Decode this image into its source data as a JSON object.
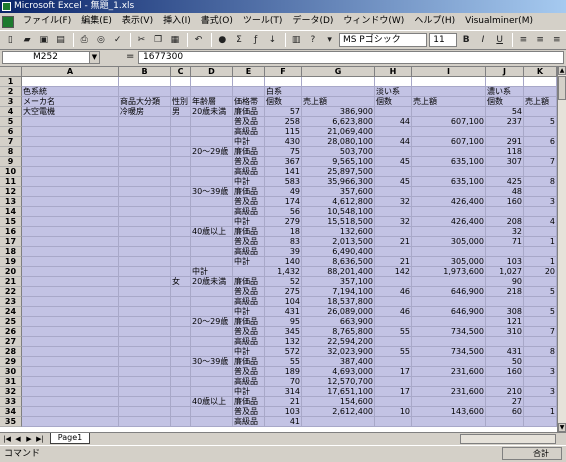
{
  "window": {
    "title": "Microsoft Excel - 無題_1.xls"
  },
  "menu": [
    "ファイル(F)",
    "編集(E)",
    "表示(V)",
    "挿入(I)",
    "書式(O)",
    "ツール(T)",
    "データ(D)",
    "ウィンドウ(W)",
    "ヘルプ(H)",
    "Visualminer(M)"
  ],
  "toolbar": {
    "font_name": "MS Pゴシック",
    "font_size": "11",
    "zoom": "Σ",
    "bold_label": "B",
    "italic_label": "I",
    "underline_label": "U"
  },
  "formula_bar": {
    "name_box": "M252",
    "eq": "=",
    "value": "1677300"
  },
  "columns": [
    "A",
    "B",
    "C",
    "D",
    "E",
    "F",
    "G",
    "H",
    "I",
    "J",
    "K"
  ],
  "rows": [
    [
      "",
      "",
      "",
      "",
      "",
      "",
      "",
      "",
      "",
      "",
      ""
    ],
    [
      "色系統",
      "",
      "",
      "",
      "",
      "白系",
      "",
      "淡い系",
      "",
      "濃い系",
      ""
    ],
    [
      "メーカ名",
      "商品大分類",
      "性別",
      "年齢層",
      "価格帯",
      "個数",
      "売上額",
      "個数",
      "売上額",
      "個数",
      "売上額"
    ],
    [
      "大空電機",
      "冷暖房",
      "男",
      "20歳未満",
      "廉価品",
      "57",
      "386,900",
      "",
      "",
      "54",
      ""
    ],
    [
      "",
      "",
      "",
      "",
      "普及品",
      "258",
      "6,623,800",
      "44",
      "607,100",
      "237",
      "5"
    ],
    [
      "",
      "",
      "",
      "",
      "高級品",
      "115",
      "21,069,400",
      "",
      "",
      "",
      ""
    ],
    [
      "",
      "",
      "",
      "",
      "中計",
      "430",
      "28,080,100",
      "44",
      "607,100",
      "291",
      "6"
    ],
    [
      "",
      "",
      "",
      "20～29歳",
      "廉価品",
      "75",
      "503,700",
      "",
      "",
      "118",
      ""
    ],
    [
      "",
      "",
      "",
      "",
      "普及品",
      "367",
      "9,565,100",
      "45",
      "635,100",
      "307",
      "7"
    ],
    [
      "",
      "",
      "",
      "",
      "高級品",
      "141",
      "25,897,500",
      "",
      "",
      "",
      ""
    ],
    [
      "",
      "",
      "",
      "",
      "中計",
      "583",
      "35,966,300",
      "45",
      "635,100",
      "425",
      "8"
    ],
    [
      "",
      "",
      "",
      "30～39歳",
      "廉価品",
      "49",
      "357,600",
      "",
      "",
      "48",
      ""
    ],
    [
      "",
      "",
      "",
      "",
      "普及品",
      "174",
      "4,612,800",
      "32",
      "426,400",
      "160",
      "3"
    ],
    [
      "",
      "",
      "",
      "",
      "高級品",
      "56",
      "10,548,100",
      "",
      "",
      "",
      ""
    ],
    [
      "",
      "",
      "",
      "",
      "中計",
      "279",
      "15,518,500",
      "32",
      "426,400",
      "208",
      "4"
    ],
    [
      "",
      "",
      "",
      "40歳以上",
      "廉価品",
      "18",
      "132,600",
      "",
      "",
      "32",
      ""
    ],
    [
      "",
      "",
      "",
      "",
      "普及品",
      "83",
      "2,013,500",
      "21",
      "305,000",
      "71",
      "1"
    ],
    [
      "",
      "",
      "",
      "",
      "高級品",
      "39",
      "6,490,400",
      "",
      "",
      "",
      ""
    ],
    [
      "",
      "",
      "",
      "",
      "中計",
      "140",
      "8,636,500",
      "21",
      "305,000",
      "103",
      "1"
    ],
    [
      "",
      "",
      "",
      "中計",
      "",
      "1,432",
      "88,201,400",
      "142",
      "1,973,600",
      "1,027",
      "20"
    ],
    [
      "",
      "",
      "女",
      "20歳未満",
      "廉価品",
      "52",
      "357,100",
      "",
      "",
      "90",
      ""
    ],
    [
      "",
      "",
      "",
      "",
      "普及品",
      "275",
      "7,194,100",
      "46",
      "646,900",
      "218",
      "5"
    ],
    [
      "",
      "",
      "",
      "",
      "高級品",
      "104",
      "18,537,800",
      "",
      "",
      "",
      ""
    ],
    [
      "",
      "",
      "",
      "",
      "中計",
      "431",
      "26,089,000",
      "46",
      "646,900",
      "308",
      "5"
    ],
    [
      "",
      "",
      "",
      "20～29歳",
      "廉価品",
      "95",
      "663,900",
      "",
      "",
      "121",
      ""
    ],
    [
      "",
      "",
      "",
      "",
      "普及品",
      "345",
      "8,765,800",
      "55",
      "734,500",
      "310",
      "7"
    ],
    [
      "",
      "",
      "",
      "",
      "高級品",
      "132",
      "22,594,200",
      "",
      "",
      "",
      ""
    ],
    [
      "",
      "",
      "",
      "",
      "中計",
      "572",
      "32,023,900",
      "55",
      "734,500",
      "431",
      "8"
    ],
    [
      "",
      "",
      "",
      "30～39歳",
      "廉価品",
      "55",
      "387,400",
      "",
      "",
      "50",
      ""
    ],
    [
      "",
      "",
      "",
      "",
      "普及品",
      "189",
      "4,693,000",
      "17",
      "231,600",
      "160",
      "3"
    ],
    [
      "",
      "",
      "",
      "",
      "高級品",
      "70",
      "12,570,700",
      "",
      "",
      "",
      ""
    ],
    [
      "",
      "",
      "",
      "",
      "中計",
      "314",
      "17,651,100",
      "17",
      "231,600",
      "210",
      "3"
    ],
    [
      "",
      "",
      "",
      "40歳以上",
      "廉価品",
      "21",
      "154,600",
      "",
      "",
      "27",
      ""
    ],
    [
      "",
      "",
      "",
      "",
      "普及品",
      "103",
      "2,612,400",
      "10",
      "143,600",
      "60",
      "1"
    ],
    [
      "",
      "",
      "",
      "",
      "高級品",
      "41",
      "",
      "",
      "",
      "",
      ""
    ]
  ],
  "sheet_tab": "Page1",
  "status": {
    "left": "コマンド",
    "right": "合計"
  }
}
